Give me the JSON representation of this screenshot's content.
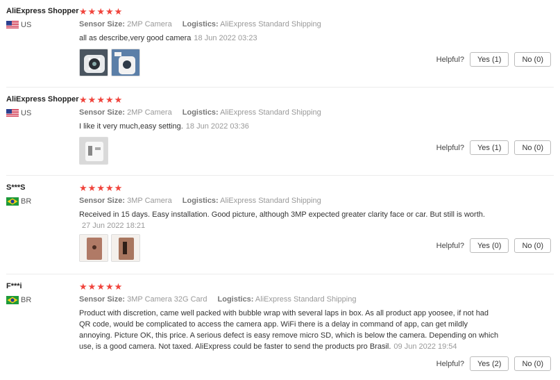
{
  "colors": {
    "star": "#f0443c",
    "divider": "#ececec"
  },
  "helpful_label": "Helpful?",
  "labels": {
    "sensor": "Sensor Size:",
    "logistics": "Logistics:"
  },
  "reviews": [
    {
      "name": "AliExpress Shopper",
      "country": "US",
      "flag": "us-flag-icon",
      "rating": 5,
      "sensor": "2MP Camera",
      "logistics": "AliExpress Standard Shipping",
      "text": "all as describe,very good camera",
      "date": "18 Jun 2022 03:23",
      "yes": "Yes (1)",
      "no": "No (0)"
    },
    {
      "name": "AliExpress Shopper",
      "country": "US",
      "flag": "us-flag-icon",
      "rating": 5,
      "sensor": "2MP Camera",
      "logistics": "AliExpress Standard Shipping",
      "text": "I like it very much,easy setting.",
      "date": "18 Jun 2022 03:36",
      "yes": "Yes (1)",
      "no": "No (0)"
    },
    {
      "name": "S***S",
      "country": "BR",
      "flag": "br-flag-icon",
      "rating": 5,
      "sensor": "3MP Camera",
      "logistics": "AliExpress Standard Shipping",
      "text": "Received in 15 days. Easy installation. Good picture, although 3MP expected greater clarity face or car. But still is worth.",
      "date": "27 Jun 2022 18:21",
      "yes": "Yes (0)",
      "no": "No (0)"
    },
    {
      "name": "F***i",
      "country": "BR",
      "flag": "br-flag-icon",
      "rating": 5,
      "sensor": "3MP Camera 32G Card",
      "logistics": "AliExpress Standard Shipping",
      "text": "Product with discretion, came well packed with bubble wrap with several laps in box. As all product app yoosee, if not had QR code, would be complicated to access the camera app. WiFi there is a delay in command of app, can get mildly annoying. Picture OK, this price. A serious defect is easy remove micro SD, which is below the camera. Depending on which use, is a good camera. Not taxed. AliExpress could be faster to send the products pro Brasil.",
      "date": "09 Jun 2022 19:54",
      "yes": "Yes (2)",
      "no": "No (0)"
    }
  ]
}
